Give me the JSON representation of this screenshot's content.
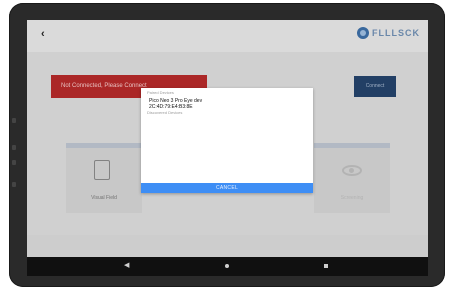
{
  "app": {
    "logo_text": "FLLLSCK"
  },
  "status": {
    "message": "Not Connected, Please Connect",
    "connect_label": "Connect"
  },
  "cards": [
    {
      "label": "Visual Field"
    },
    {
      "label": "Screening"
    }
  ],
  "dialog": {
    "paired_header": "Paired Devices",
    "devices": [
      {
        "name": "Pico Neo 3 Pro Eye dev",
        "address": "2C:4D:79:E4:B3:8E"
      }
    ],
    "discovered_header": "Discovered Devices",
    "cancel_label": "CANCEL"
  },
  "colors": {
    "status_red": "#b52a2a",
    "connect_blue": "#24436b",
    "cancel_blue": "#3e8ef5"
  }
}
